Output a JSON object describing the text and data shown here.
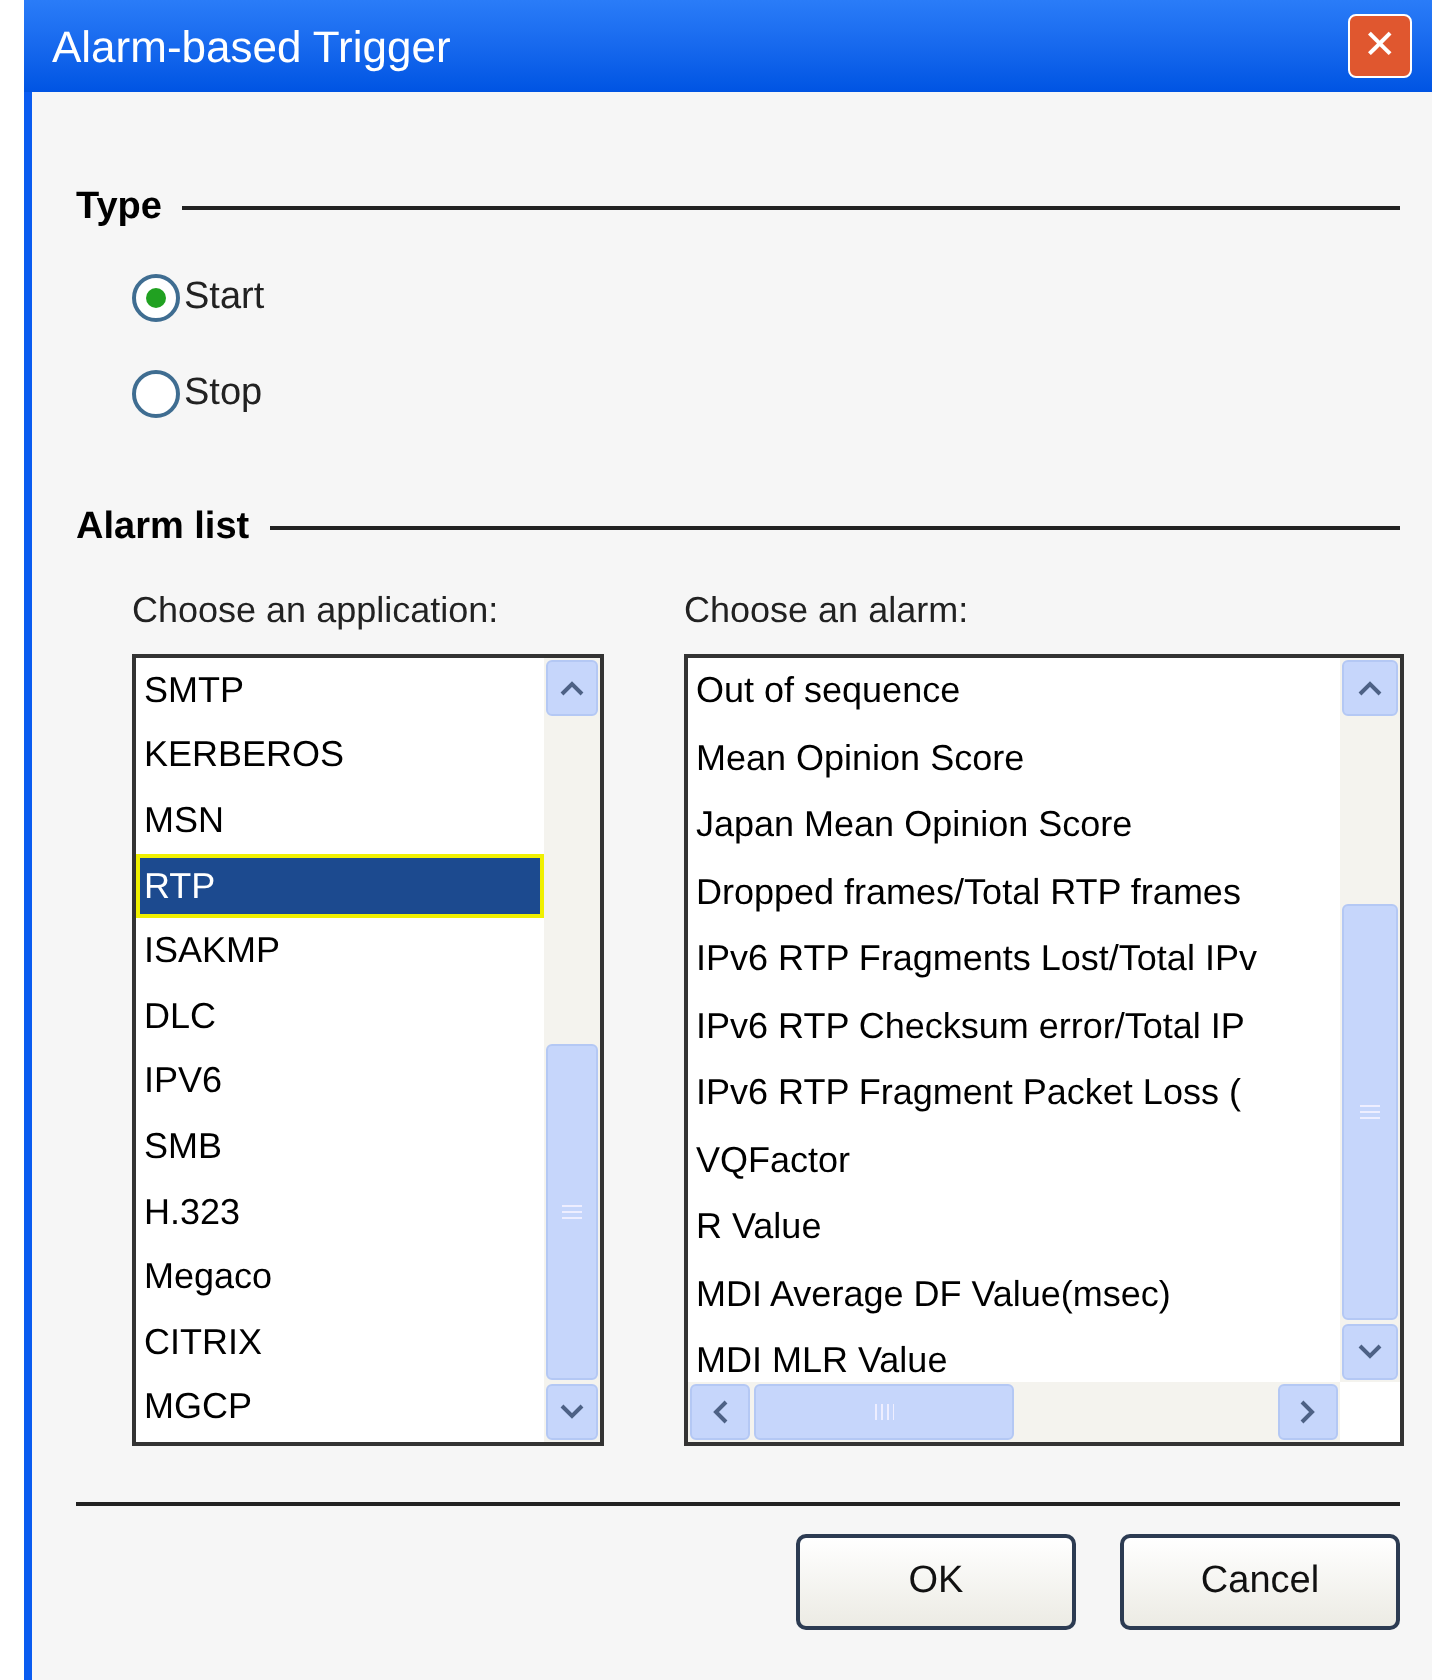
{
  "window": {
    "title": "Alarm-based Trigger",
    "close": "✕"
  },
  "type": {
    "legend": "Type",
    "options": [
      {
        "label": "Start",
        "selected": true
      },
      {
        "label": "Stop",
        "selected": false
      }
    ]
  },
  "alarm_list": {
    "legend": "Alarm list",
    "applications": {
      "label": "Choose an application:",
      "items": [
        {
          "label": "SMTP",
          "selected": false
        },
        {
          "label": "KERBEROS",
          "selected": false
        },
        {
          "label": "MSN",
          "selected": false
        },
        {
          "label": "RTP",
          "selected": true
        },
        {
          "label": "ISAKMP",
          "selected": false
        },
        {
          "label": "DLC",
          "selected": false
        },
        {
          "label": "IPV6",
          "selected": false
        },
        {
          "label": "SMB",
          "selected": false
        },
        {
          "label": "H.323",
          "selected": false
        },
        {
          "label": "Megaco",
          "selected": false
        },
        {
          "label": "CITRIX",
          "selected": false
        },
        {
          "label": "MGCP",
          "selected": false
        }
      ]
    },
    "alarms": {
      "label": "Choose an alarm:",
      "items": [
        "Out of sequence",
        "Mean Opinion Score",
        "Japan Mean Opinion Score",
        "Dropped frames/Total RTP frames",
        "IPv6 RTP Fragments Lost/Total IPv",
        "IPv6 RTP Checksum error/Total IP",
        "IPv6 RTP Fragment Packet Loss (",
        "VQFactor",
        "R Value",
        "MDI Average DF Value(msec)",
        "MDI MLR Value"
      ]
    }
  },
  "buttons": [
    "OK",
    "Cancel"
  ]
}
